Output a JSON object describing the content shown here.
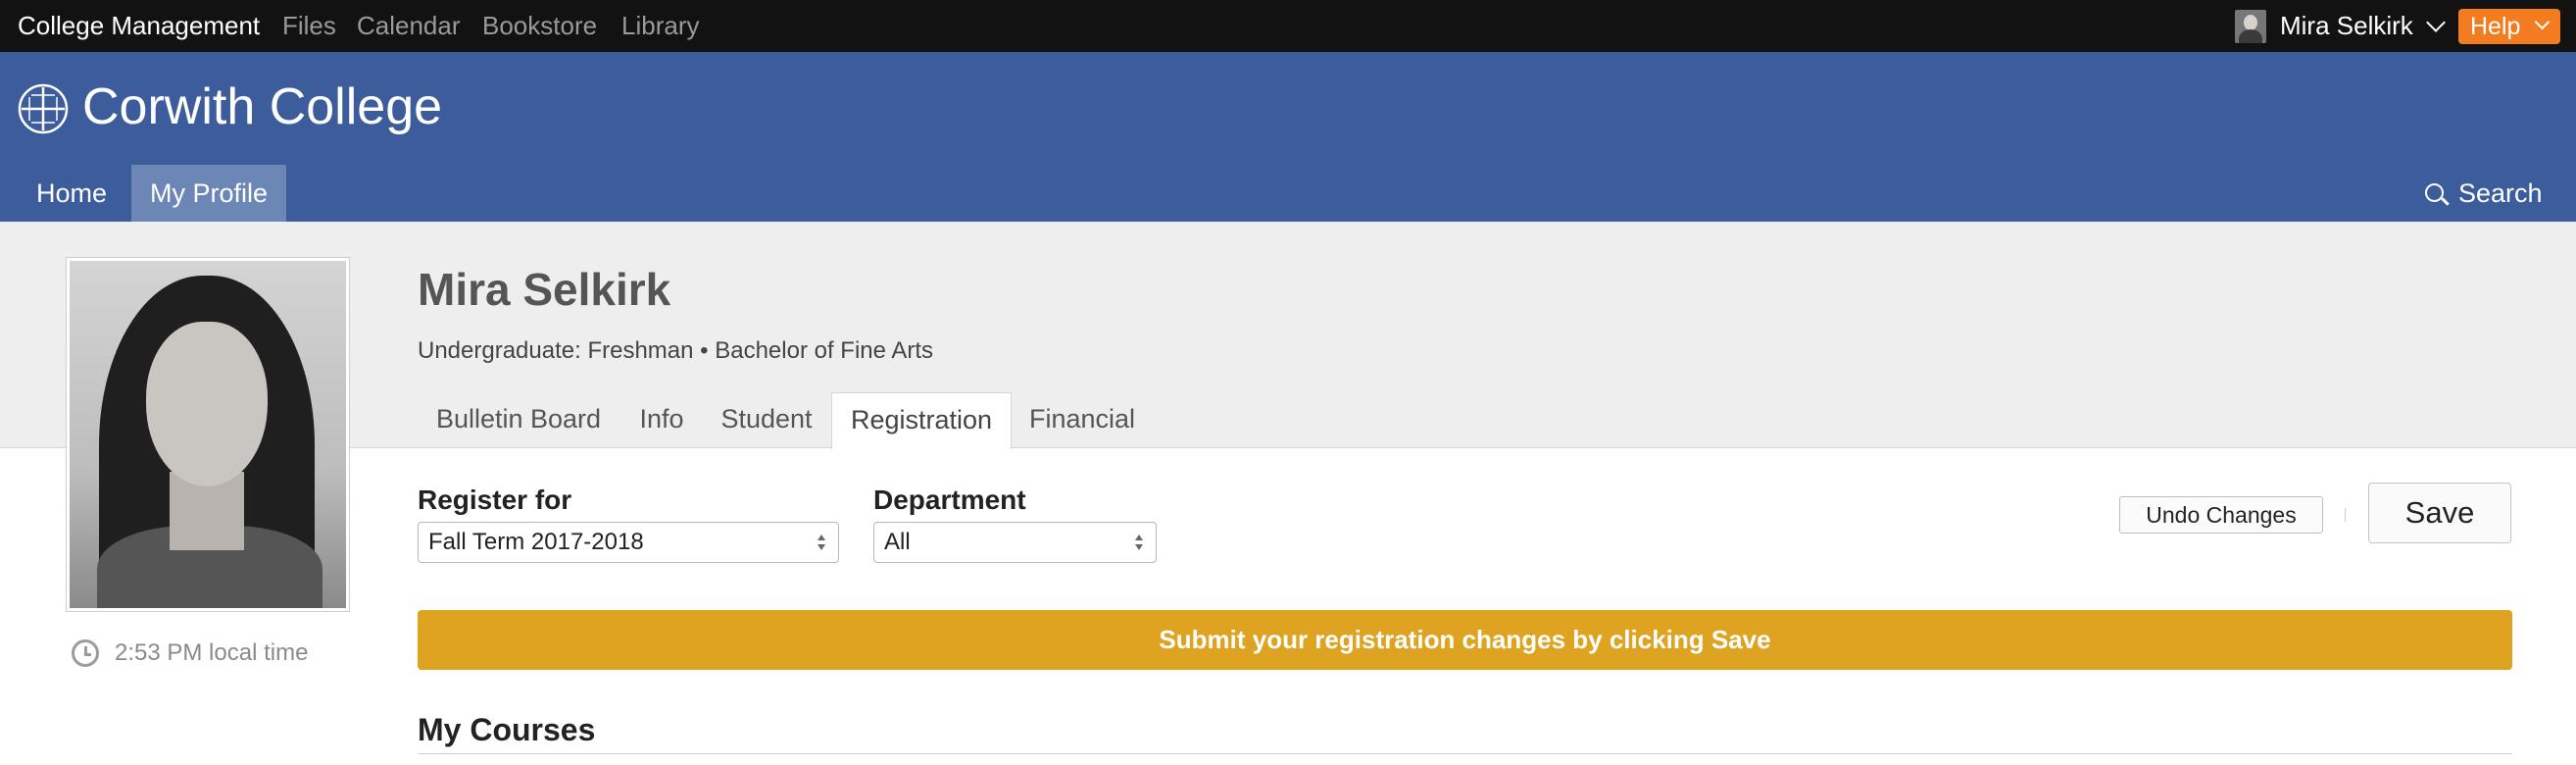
{
  "topbar": {
    "brand": "College Management",
    "links": [
      "Files",
      "Calendar",
      "Bookstore",
      "Library"
    ],
    "user_name": "Mira Selkirk",
    "help_label": "Help"
  },
  "header": {
    "college_name": "Corwith College",
    "nav": [
      "Home",
      "My Profile"
    ],
    "search_label": "Search"
  },
  "profile": {
    "name": "Mira Selkirk",
    "subtitle": "Undergraduate: Freshman • Bachelor of Fine Arts",
    "local_time": "2:53 PM local time",
    "tabs": [
      "Bulletin Board",
      "Info",
      "Student",
      "Registration",
      "Financial"
    ],
    "active_tab": "Registration"
  },
  "registration": {
    "register_for_label": "Register for",
    "register_for_value": "Fall Term 2017-2018",
    "department_label": "Department",
    "department_value": "All",
    "undo_label": "Undo Changes",
    "save_label": "Save",
    "notice": "Submit your registration changes by clicking Save",
    "courses_heading": "My Courses"
  },
  "colors": {
    "topbar": "#121212",
    "header": "#3c5c9c",
    "active_nav": "#6c86b6",
    "help": "#f47c20",
    "notice": "#dea421"
  }
}
